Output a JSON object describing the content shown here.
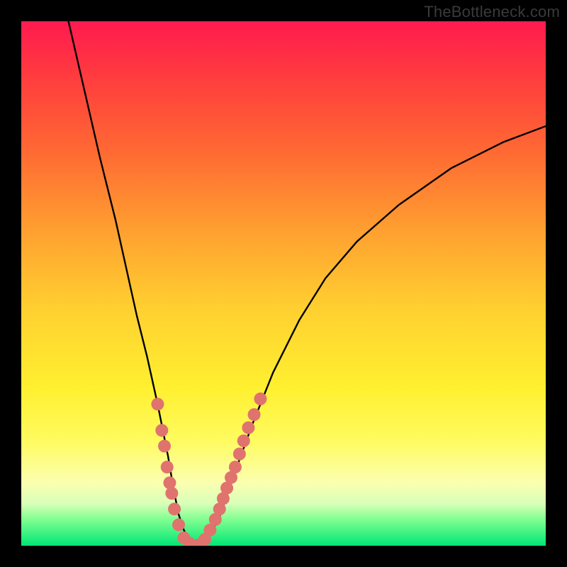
{
  "watermark": "TheBottleneck.com",
  "chart_data": {
    "type": "line",
    "title": "",
    "xlabel": "",
    "ylabel": "",
    "xlim": [
      0,
      100
    ],
    "ylim": [
      0,
      100
    ],
    "series": [
      {
        "name": "curve",
        "x": [
          9,
          12,
          15,
          18,
          20,
          22,
          24,
          26,
          27,
          28,
          29,
          30,
          31,
          32,
          33,
          34,
          36,
          38,
          40,
          44,
          48,
          53,
          58,
          64,
          72,
          82,
          92,
          100
        ],
        "y": [
          100,
          87,
          74,
          62,
          53,
          44,
          36,
          27,
          22,
          17,
          11,
          6,
          3,
          1,
          0,
          0,
          2,
          6,
          12,
          23,
          33,
          43,
          51,
          58,
          65,
          72,
          77,
          80
        ]
      }
    ],
    "markers": {
      "name": "highlight-dots",
      "color": "#e0736e",
      "points": [
        {
          "x": 26.0,
          "y": 27
        },
        {
          "x": 26.8,
          "y": 22
        },
        {
          "x": 27.3,
          "y": 19
        },
        {
          "x": 27.8,
          "y": 15
        },
        {
          "x": 28.3,
          "y": 12
        },
        {
          "x": 28.7,
          "y": 10
        },
        {
          "x": 29.2,
          "y": 7
        },
        {
          "x": 30.0,
          "y": 4
        },
        {
          "x": 31.0,
          "y": 1.5
        },
        {
          "x": 32.0,
          "y": 0.5
        },
        {
          "x": 33.0,
          "y": 0
        },
        {
          "x": 34.0,
          "y": 0.2
        },
        {
          "x": 35.0,
          "y": 1.2
        },
        {
          "x": 36.0,
          "y": 3
        },
        {
          "x": 37.0,
          "y": 5
        },
        {
          "x": 37.8,
          "y": 7
        },
        {
          "x": 38.5,
          "y": 9
        },
        {
          "x": 39.2,
          "y": 11
        },
        {
          "x": 40.0,
          "y": 13
        },
        {
          "x": 40.8,
          "y": 15
        },
        {
          "x": 41.6,
          "y": 17.5
        },
        {
          "x": 42.4,
          "y": 20
        },
        {
          "x": 43.3,
          "y": 22.5
        },
        {
          "x": 44.4,
          "y": 25
        },
        {
          "x": 45.6,
          "y": 28
        }
      ]
    }
  }
}
